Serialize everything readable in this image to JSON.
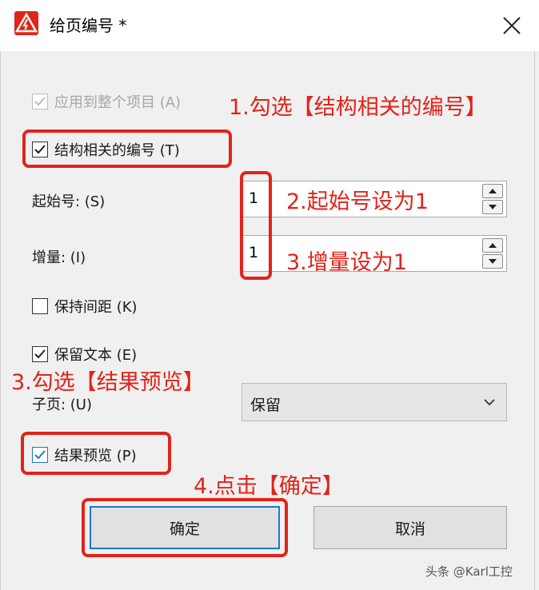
{
  "window": {
    "title": "给页编号 *"
  },
  "options": {
    "apply_whole_project": {
      "label": "应用到整个项目 (A)",
      "checked": true,
      "disabled": true
    },
    "structure_numbering": {
      "label": "结构相关的编号 (T)",
      "checked": true
    },
    "keep_spacing": {
      "label": "保持间距 (K)",
      "checked": false
    },
    "keep_text": {
      "label": "保留文本 (E)",
      "checked": true
    },
    "preview": {
      "label": "结果预览 (P)",
      "checked": true
    }
  },
  "fields": {
    "start_number": {
      "label": "起始号: (S)",
      "value": "1"
    },
    "increment": {
      "label": "增量: (I)",
      "value": "1"
    },
    "subpage": {
      "label": "子页: (U)",
      "value": "保留"
    }
  },
  "buttons": {
    "ok": "确定",
    "cancel": "取消"
  },
  "annotations": {
    "step1": "1.勾选【结构相关的编号】",
    "step2": "2.起始号设为1",
    "step3": "3.增量设为1",
    "step3b": "3.勾选【结果预览】",
    "step4": "4.点击【确定】"
  },
  "watermark": "头条 @Karl工控",
  "colors": {
    "annotation": "#e2231a",
    "focus_border": "#1d76d3",
    "dialog_bg": "#f0f0f0"
  }
}
